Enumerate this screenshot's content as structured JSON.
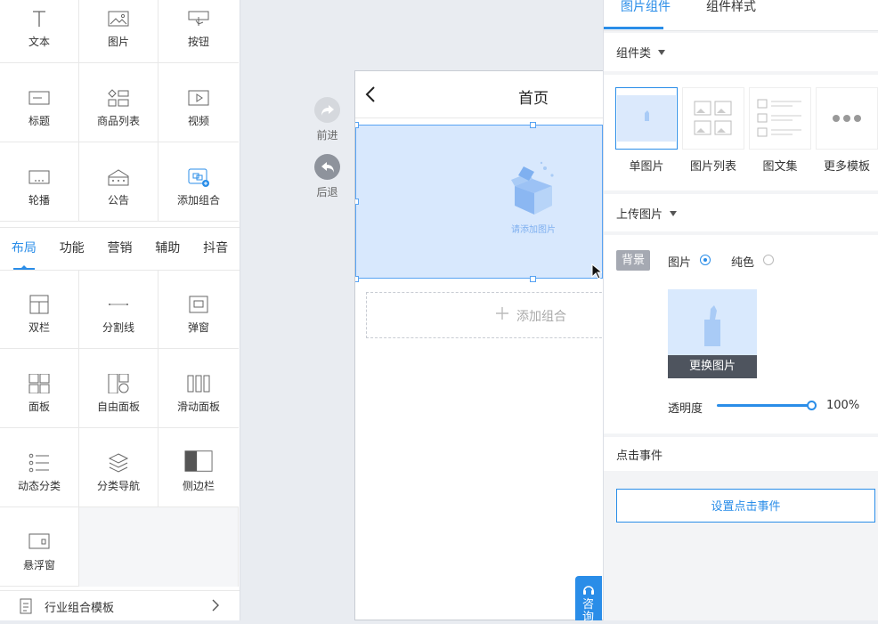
{
  "left_panel": {
    "basic_items": [
      {
        "label": "文本",
        "icon": "text-icon"
      },
      {
        "label": "图片",
        "icon": "image-icon"
      },
      {
        "label": "按钮",
        "icon": "button-icon"
      },
      {
        "label": "标题",
        "icon": "title-icon"
      },
      {
        "label": "商品列表",
        "icon": "product-list-icon"
      },
      {
        "label": "视频",
        "icon": "video-icon"
      },
      {
        "label": "轮播",
        "icon": "carousel-icon"
      },
      {
        "label": "公告",
        "icon": "notice-icon"
      },
      {
        "label": "添加组合",
        "icon": "add-group-icon"
      }
    ],
    "tabs": [
      "布局",
      "功能",
      "营销",
      "辅助",
      "抖音"
    ],
    "active_tab": "布局",
    "layout_items": [
      {
        "label": "双栏",
        "icon": "two-column-icon"
      },
      {
        "label": "分割线",
        "icon": "divider-icon"
      },
      {
        "label": "弹窗",
        "icon": "popup-icon"
      },
      {
        "label": "面板",
        "icon": "panel-icon"
      },
      {
        "label": "自由面板",
        "icon": "free-panel-icon"
      },
      {
        "label": "滑动面板",
        "icon": "sliding-panel-icon"
      },
      {
        "label": "动态分类",
        "icon": "dynamic-category-icon"
      },
      {
        "label": "分类导航",
        "icon": "category-nav-icon"
      },
      {
        "label": "侧边栏",
        "icon": "sidebar-icon"
      },
      {
        "label": "悬浮窗",
        "icon": "floating-window-icon"
      }
    ],
    "industry_template": "行业组合模板"
  },
  "history": {
    "redo_label": "前进",
    "undo_label": "后退"
  },
  "canvas": {
    "page_title": "首页",
    "image_placeholder": "请添加图片",
    "add_group_label": "添加组合",
    "consult_label": "咨询"
  },
  "right_panel": {
    "tabs": [
      "图片组件",
      "组件样式"
    ],
    "active_tab": "图片组件",
    "component_type_title": "组件类",
    "templates": [
      {
        "label": "单图片",
        "active": true
      },
      {
        "label": "图片列表",
        "active": false
      },
      {
        "label": "图文集",
        "active": false
      },
      {
        "label": "更多模板",
        "active": false
      }
    ],
    "upload_title": "上传图片",
    "background_label": "背景",
    "bg_options": [
      "图片",
      "纯色"
    ],
    "bg_selected": "图片",
    "replace_image_label": "更换图片",
    "opacity_label": "透明度",
    "opacity_value": "100%",
    "opacity_fraction": 1.0,
    "click_event_title": "点击事件",
    "set_click_event_label": "设置点击事件"
  },
  "colors": {
    "accent": "#2a8de8",
    "selection_fill": "#d8e8fd"
  }
}
